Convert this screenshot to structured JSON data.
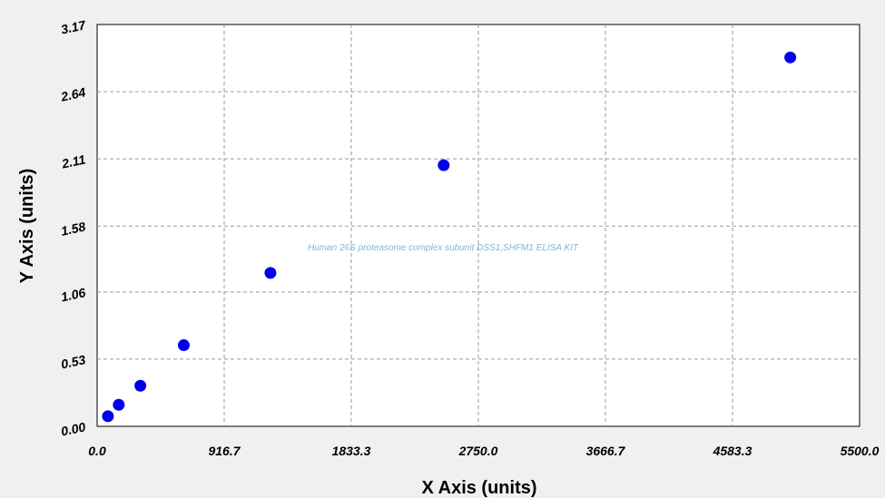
{
  "chart_data": {
    "type": "scatter",
    "watermark": "Human 26S proteasome complex subunit DSS1,SHFM1 ELISA KIT",
    "xlabel": "X Axis (units)",
    "ylabel": "Y Axis (units)",
    "xlim": [
      0,
      5500
    ],
    "ylim": [
      0,
      3.17
    ],
    "x_ticks": [
      "0.0",
      "916.7",
      "1833.3",
      "2750.0",
      "3666.7",
      "4583.3",
      "5500.0"
    ],
    "x_tick_values": [
      0,
      916.7,
      1833.3,
      2750.0,
      3666.7,
      4583.3,
      5500.0
    ],
    "y_ticks": [
      "0.00",
      "0.53",
      "1.06",
      "1.58",
      "2.11",
      "2.64",
      "3.17"
    ],
    "y_tick_values": [
      0.0,
      0.53,
      1.06,
      1.58,
      2.11,
      2.64,
      3.17
    ],
    "grid": true,
    "marker_color": "#0000ee",
    "points": [
      {
        "x": 78,
        "y": 0.08
      },
      {
        "x": 156,
        "y": 0.17
      },
      {
        "x": 312,
        "y": 0.32
      },
      {
        "x": 625,
        "y": 0.64
      },
      {
        "x": 1250,
        "y": 1.21
      },
      {
        "x": 2500,
        "y": 2.06
      },
      {
        "x": 5000,
        "y": 2.91
      }
    ]
  }
}
